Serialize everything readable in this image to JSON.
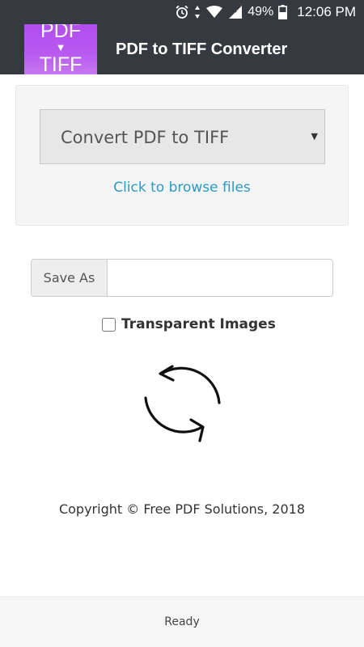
{
  "status_bar": {
    "battery": "49%",
    "time": "12:06 PM",
    "icons": [
      "alarm-icon",
      "data-arrows-icon",
      "wifi-icon",
      "cell-signal-icon",
      "battery-icon"
    ]
  },
  "app_bar": {
    "logo": {
      "line1": "PDF",
      "arrow": "▼",
      "line2": "TIFF"
    },
    "title": "PDF to TIFF Converter",
    "background": "#353a41",
    "logo_color": "#b85bef"
  },
  "upload_panel": {
    "select": {
      "value": "Convert PDF to TIFF",
      "caret": "▼"
    },
    "browse_link": "Click to browse files",
    "link_color": "#2a9ac7"
  },
  "save_as": {
    "addon_label": "Save As",
    "value": "",
    "placeholder": ""
  },
  "options": {
    "transparent_images": {
      "label": "Transparent Images",
      "checked": false
    }
  },
  "convert_button": {
    "icon": "convert-sync-icon"
  },
  "copyright": "Copyright © Free PDF Solutions, 2018",
  "footer": {
    "status": "Ready"
  }
}
